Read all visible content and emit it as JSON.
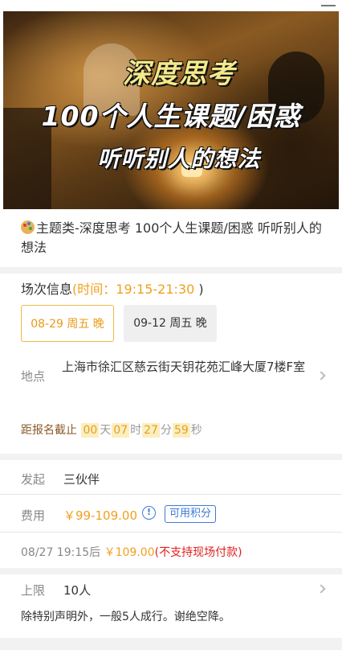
{
  "header": {
    "menu_icon": "menu-icon"
  },
  "banner": {
    "line1": "深度思考",
    "line2": "100个人生课题/困惑",
    "line3": "听听别人的想法"
  },
  "event": {
    "title_icon": "palette-icon",
    "title": "主题类-深度思考 100个人生课题/困惑 听听别人的想法"
  },
  "session": {
    "label": "场次信息",
    "open_paren": "(",
    "time_label": "时间：",
    "time_value": "19:15-21:30",
    "close_paren": " )",
    "options": [
      {
        "label": "08-29 周五 晚",
        "selected": true
      },
      {
        "label": "09-12 周五 晚",
        "selected": false
      }
    ]
  },
  "location": {
    "label": "地点",
    "address": "上海市徐汇区慈云街天钥花苑汇峰大厦7楼F室"
  },
  "countdown": {
    "label": "距报名截止",
    "days": "00",
    "days_unit": "天",
    "hours": "07",
    "hours_unit": "时",
    "minutes": "27",
    "minutes_unit": "分",
    "seconds": "59",
    "seconds_unit": "秒"
  },
  "organizer": {
    "label": "发起",
    "value": "三伙伴"
  },
  "fee": {
    "label": "费用",
    "price": "￥99-109.00",
    "info_icon": "!",
    "points_button": "可用积分"
  },
  "after_deadline": {
    "time": "08/27 19:15后",
    "amount": "￥109.00",
    "note": "(不支持现场付款)"
  },
  "limit": {
    "label": "上限",
    "value": "10人",
    "note": "除特别声明外，一般5人成行。谢绝空降。"
  },
  "colors": {
    "accent": "#f0a020",
    "link": "#3b7ad9",
    "warning": "#e02020"
  }
}
